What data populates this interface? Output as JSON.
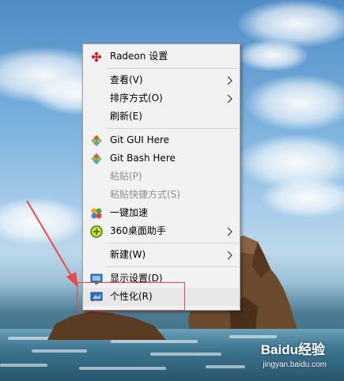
{
  "menu": {
    "radeon_label": "Radeon 设置",
    "view_label": "查看(V)",
    "sort_label": "排序方式(O)",
    "refresh_label": "刷新(E)",
    "git_gui_label": "Git GUI Here",
    "git_bash_label": "Git Bash Here",
    "paste_label": "粘贴(P)",
    "paste_shortcut_label": "粘贴快捷方式(S)",
    "speedup_label": "一键加速",
    "desktop_helper_label": "360桌面助手",
    "new_label": "新建(W)",
    "display_label": "显示设置(D)",
    "personalize_label": "个性化(R)"
  },
  "watermark": {
    "logo_text": "Baidu经验",
    "url": "jingyan.baidu.com"
  },
  "colors": {
    "annotation": "#e84a4a",
    "menu_bg": "#f2f2f2",
    "disabled_text": "#8f8f8f"
  },
  "icons": [
    "radeon-icon",
    "git-gui-icon",
    "git-bash-icon",
    "speedup-icon",
    "desktop-helper-icon",
    "display-settings-icon",
    "personalize-icon",
    "chevron-right-icon"
  ]
}
